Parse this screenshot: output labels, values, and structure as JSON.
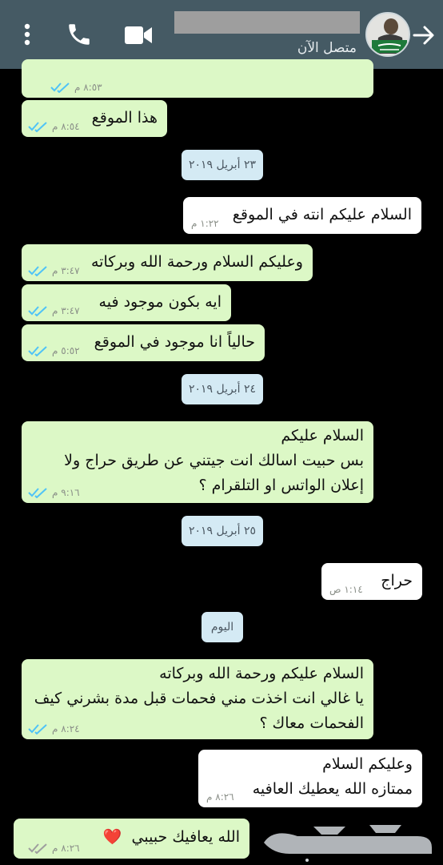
{
  "header": {
    "status": "متصل الآن",
    "icons": [
      "more-vert-icon",
      "phone-icon",
      "video-call-icon",
      "arrow-back-icon"
    ]
  },
  "messages": [
    {
      "type": "out",
      "text": "",
      "time": "٨:٥٣ م"
    },
    {
      "type": "out",
      "text": "هذا الموقع",
      "time": "٨:٥٤ م"
    },
    {
      "type": "date",
      "text": "٢٣ أبريل ٢٠١٩"
    },
    {
      "type": "in",
      "text": "السلام عليكم انته في الموقع",
      "time": "١:٢٢ م"
    },
    {
      "type": "out",
      "text": "وعليكم السلام ورحمة الله وبركاته",
      "time": "٣:٤٧ م"
    },
    {
      "type": "out",
      "text": "ايه بكون موجود فيه",
      "time": "٣:٤٧ م"
    },
    {
      "type": "out",
      "text": "حالياً انا موجود في الموقع",
      "time": "٥:٥٢ م"
    },
    {
      "type": "date",
      "text": "٢٤ أبريل ٢٠١٩"
    },
    {
      "type": "out",
      "lines": [
        "السلام عليكم",
        "بس حبيت اسالك انت جيتني عن طريق حراج ولا",
        "إعلان الواتس او التلقرام ؟"
      ],
      "time": "٩:١٦ م"
    },
    {
      "type": "date",
      "text": "٢٥ أبريل ٢٠١٩"
    },
    {
      "type": "in",
      "text": "حراج",
      "time": "١:١٤ ص"
    },
    {
      "type": "date",
      "text": "اليوم"
    },
    {
      "type": "out",
      "lines": [
        "السلام عليكم ورحمة الله وبركاته",
        "يا غالي انت اخذت مني فحمات قبل مدة بشرني كيف",
        "الفحمات معاك ؟"
      ],
      "time": "٨:٢٤ م"
    },
    {
      "type": "in",
      "lines": [
        "وعليكم السلام",
        "ممتازه الله يعطيك العافيه"
      ],
      "time": "٨:٢٦ م"
    },
    {
      "type": "out",
      "text": "الله يعافيك حبيبي",
      "emoji": "❤️",
      "time": "٨:٢٦ م"
    }
  ],
  "watermark": {
    "text": "حراج"
  },
  "colors": {
    "header": "#455a64",
    "background": "#000000",
    "outgoing": "#dcf8c6",
    "incoming": "#ffffff",
    "date_chip": "#d4eaf4",
    "read_ticks": "#4fc3f7"
  }
}
